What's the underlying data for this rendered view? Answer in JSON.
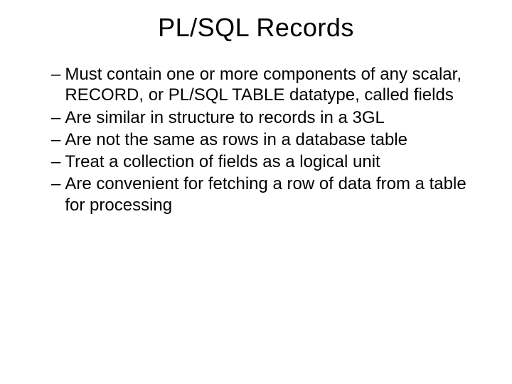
{
  "slide": {
    "title": "PL/SQL Records",
    "bullets": [
      "Must contain one or more components of any scalar, RECORD, or PL/SQL TABLE datatype, called fields",
      "Are similar in structure to records in a 3GL",
      "Are not the same as rows in a database table",
      "Treat a collection of fields as a logical unit",
      "Are convenient for fetching a row of data from a table for processing"
    ],
    "dash": "–"
  }
}
